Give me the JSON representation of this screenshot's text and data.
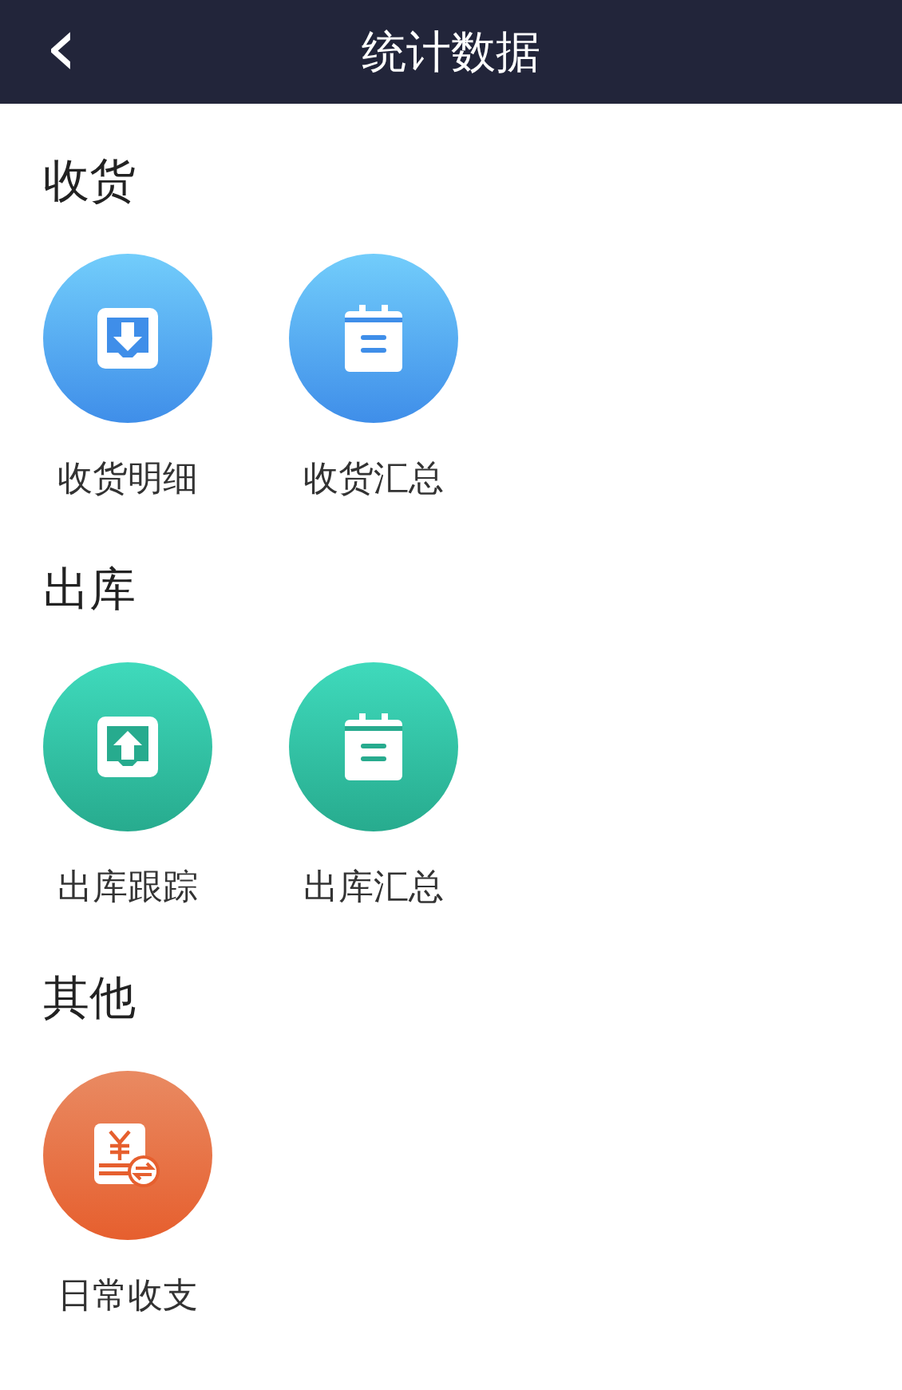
{
  "header": {
    "back_icon": "‹",
    "title": "统计数据"
  },
  "sections": [
    {
      "title": "收货",
      "tiles": [
        {
          "label": "收货明细",
          "kind": "download"
        },
        {
          "label": "收货汇总",
          "kind": "notepad"
        }
      ]
    },
    {
      "title": "出库",
      "tiles": [
        {
          "label": "出库跟踪",
          "kind": "upload"
        },
        {
          "label": "出库汇总",
          "kind": "notepad"
        }
      ]
    },
    {
      "title": "其他",
      "tiles": [
        {
          "label": "日常收支",
          "kind": "bill"
        }
      ]
    }
  ]
}
